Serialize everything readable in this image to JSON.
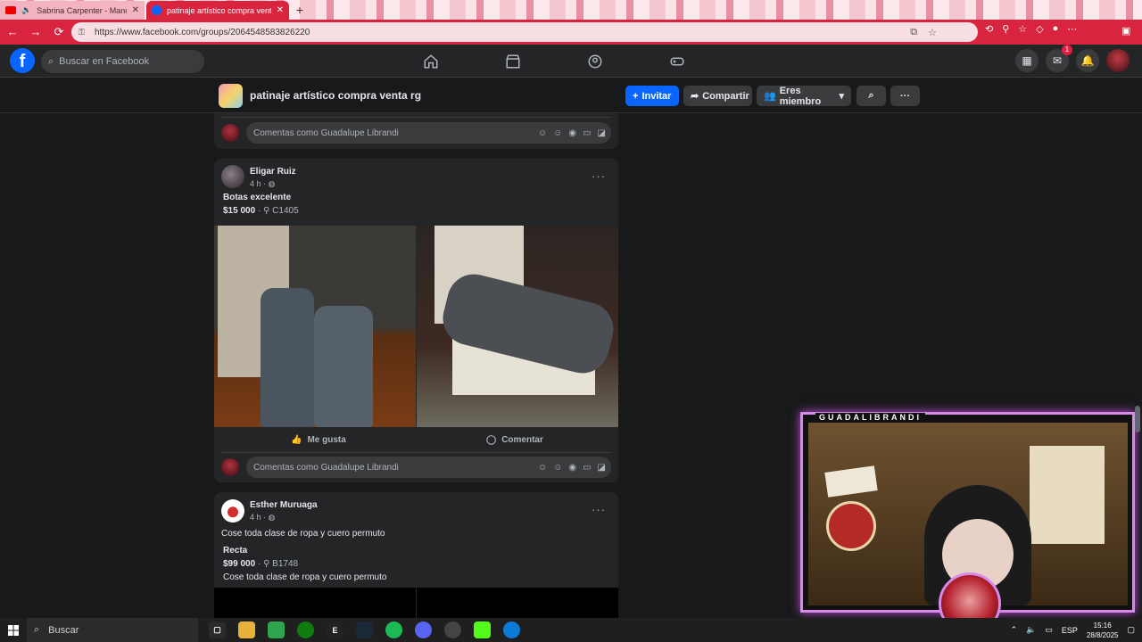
{
  "browser": {
    "tabs": [
      {
        "title": "Sabrina Carpenter - Manchild",
        "active": false
      },
      {
        "title": "patinaje artístico compra venta rg",
        "active": true
      }
    ],
    "url": "https://www.facebook.com/groups/2064548583826220"
  },
  "fb": {
    "search_placeholder": "Buscar en Facebook",
    "notifications_badge": "1"
  },
  "group": {
    "title": "patinaje artístico compra venta rg",
    "invite_label": "Invitar",
    "share_label": "Compartir",
    "member_label": "Eres miembro"
  },
  "comment_placeholder": "Comentas como Guadalupe Librandi",
  "posts": [
    {
      "author": "Eligar Ruiz",
      "time": "4 h ·",
      "title": "Botas excelente",
      "price": "$15 000",
      "location": "C1405",
      "like_label": "Me gusta",
      "comment_label": "Comentar"
    },
    {
      "author": "Esther Muruaga",
      "time": "4 h ·",
      "body": "Cose toda clase de ropa y cuero permuto",
      "title": "Recta",
      "price": "$99 000",
      "location": "B1748",
      "description": "Cose toda clase de ropa y cuero permuto"
    }
  ],
  "stream": {
    "label": "GUADALIBRANDI"
  },
  "taskbar": {
    "search_label": "Buscar",
    "lang": "ESP",
    "time": "15:16",
    "date": "28/8/2025"
  }
}
